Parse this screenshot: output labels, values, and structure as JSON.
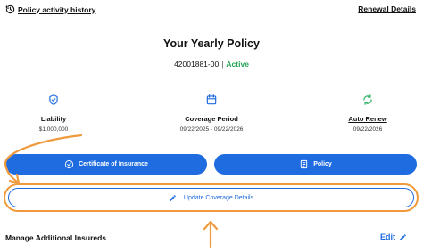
{
  "header": {
    "history_label": "Policy activity history",
    "renewal_label": "Renewal Details"
  },
  "policy": {
    "title": "Your Yearly Policy",
    "number": "42001881-00",
    "separator": "|",
    "status": "Active"
  },
  "info": [
    {
      "icon": "shield-check-icon",
      "label": "Liability",
      "value": "$1,000,000"
    },
    {
      "icon": "calendar-icon",
      "label": "Coverage Period",
      "value": "09/22/2025 - 09/22/2026"
    },
    {
      "icon": "auto-renew-icon",
      "label": "Auto Renew",
      "value": "09/22/2026"
    }
  ],
  "actions": {
    "certificate_label": "Certificate of Insurance",
    "policy_label": "Policy",
    "update_label": "Update Coverage Details"
  },
  "additional": {
    "title": "Manage Additional Insureds",
    "edit_label": "Edit"
  },
  "colors": {
    "primary_blue": "#1f6be0",
    "status_green": "#23a455",
    "renew_icon_green": "#3bb36b",
    "annotation_orange": "#ef9a3d"
  }
}
